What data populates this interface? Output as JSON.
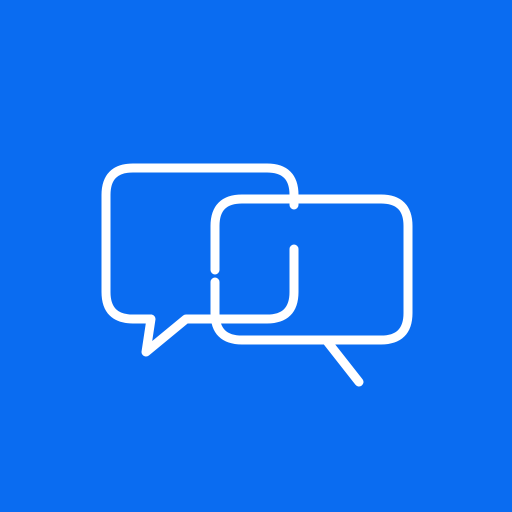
{
  "icon": {
    "name": "chat-bubbles-icon",
    "background_color": "#0a6cf1",
    "stroke_color": "#ffffff"
  }
}
